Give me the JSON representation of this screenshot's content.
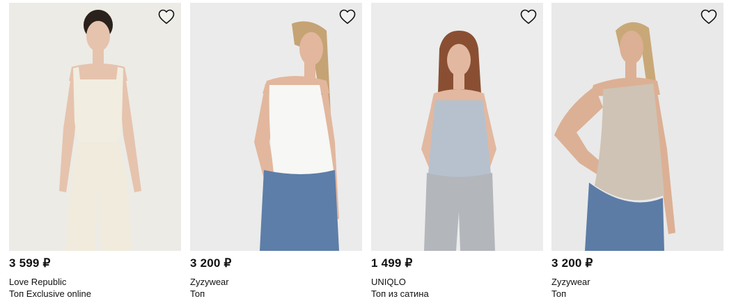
{
  "products": [
    {
      "price": "3 599 ₽",
      "brand": "Love Republic",
      "name": "Топ Exclusive online",
      "bg": "#ecebe6",
      "top_color": "#f1ede0",
      "bottom_color": "#f0ebdd",
      "skin": "#e6c3ad",
      "hair": "#2a211c"
    },
    {
      "price": "3 200 ₽",
      "brand": "Zyzywear",
      "name": "Топ",
      "bg": "#ebebeb",
      "top_color": "#f7f7f5",
      "bottom_color": "#5d7ea8",
      "skin": "#e2b79d",
      "hair": "#c5a374"
    },
    {
      "price": "1 499 ₽",
      "brand": "UNIQLO",
      "name": "Топ из сатина",
      "bg": "#ececec",
      "top_color": "#b6c1cd",
      "bottom_color": "#b3b6bb",
      "skin": "#e2b8a0",
      "hair": "#8a4f33"
    },
    {
      "price": "3 200 ₽",
      "brand": "Zyzywear",
      "name": "Топ",
      "bg": "#e9e9e9",
      "top_color": "#cfc3b5",
      "bottom_color": "#5c7ca6",
      "skin": "#dcb094",
      "hair": "#c9a878"
    }
  ],
  "icons": {
    "favorite": "heart-outline-icon"
  }
}
